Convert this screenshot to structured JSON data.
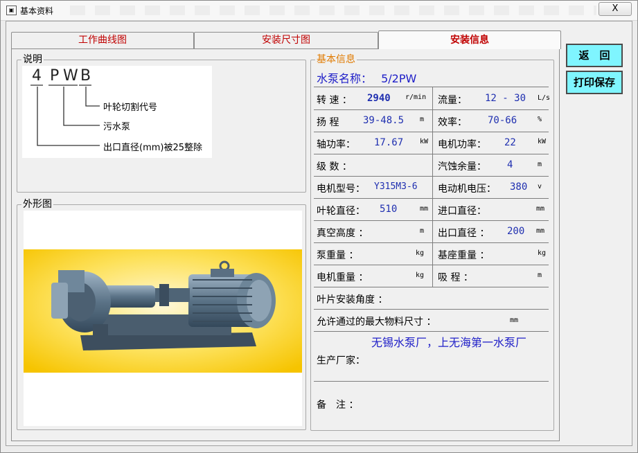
{
  "window": {
    "title": "基本资料",
    "close_label": "X"
  },
  "tabs": [
    {
      "label": "工作曲线图"
    },
    {
      "label": "安装尺寸图"
    },
    {
      "label": "安装信息"
    }
  ],
  "buttons": {
    "back": "返　回",
    "print_save": "打印保存"
  },
  "explain": {
    "title": "说明",
    "code_chars": [
      "4",
      "P",
      "W",
      "B"
    ],
    "labels": [
      "叶轮切割代号",
      "污水泵",
      "出口直径(mm)被25整除"
    ]
  },
  "appearance": {
    "title": "外形图"
  },
  "basic_info": {
    "title": "基本信息",
    "pump_name_label": "水泵名称：",
    "pump_name": "5/2PW",
    "rows": [
      {
        "l_label": "转 速 ：",
        "l_value": "2940",
        "l_unit": "r/min",
        "r_label": "流量：",
        "r_value": "12 - 30",
        "r_unit": "L/s"
      },
      {
        "l_label": "扬 程",
        "l_value": "39-48.5",
        "l_unit": "m",
        "r_label": "效率：",
        "r_value": "70-66",
        "r_unit": "%"
      },
      {
        "l_label": "轴功率：",
        "l_value": "17.67",
        "l_unit": "kW",
        "r_label": "电机功率：",
        "r_value": "22",
        "r_unit": "kW"
      },
      {
        "l_label": "级 数 ：",
        "l_value": "",
        "l_unit": "",
        "r_label": "汽蚀余量：",
        "r_value": "4",
        "r_unit": "m"
      },
      {
        "l_label": "电机型号：",
        "l_value": "Y315M3-6",
        "l_unit": "",
        "r_label": "电动机电压：",
        "r_value": "380",
        "r_unit": "v"
      },
      {
        "l_label": "叶轮直径：",
        "l_value": "510",
        "l_unit": "mm",
        "r_label": "进口直径：",
        "r_value": "",
        "r_unit": "mm"
      },
      {
        "l_label": "真空高度 ：",
        "l_value": "",
        "l_unit": "m",
        "r_label": "出口直径 ：",
        "r_value": "200",
        "r_unit": "mm"
      },
      {
        "l_label": "泵重量 ：",
        "l_value": "",
        "l_unit": "kg",
        "r_label": "基座重量 ：",
        "r_value": "",
        "r_unit": "kg"
      },
      {
        "l_label": "电机重量 ：",
        "l_value": "",
        "l_unit": "kg",
        "r_label": "吸 程 ：",
        "r_value": "",
        "r_unit": "m"
      }
    ],
    "blade_angle_label": "叶片安装角度 ：",
    "max_material_label": "允许通过的最大物料尺寸 ：",
    "max_material_unit": "mm",
    "manufacturer_label": "生产厂家：",
    "manufacturer_value": "无锡水泵厂，上无海第一水泵厂",
    "remark_label": "备　注 ："
  }
}
